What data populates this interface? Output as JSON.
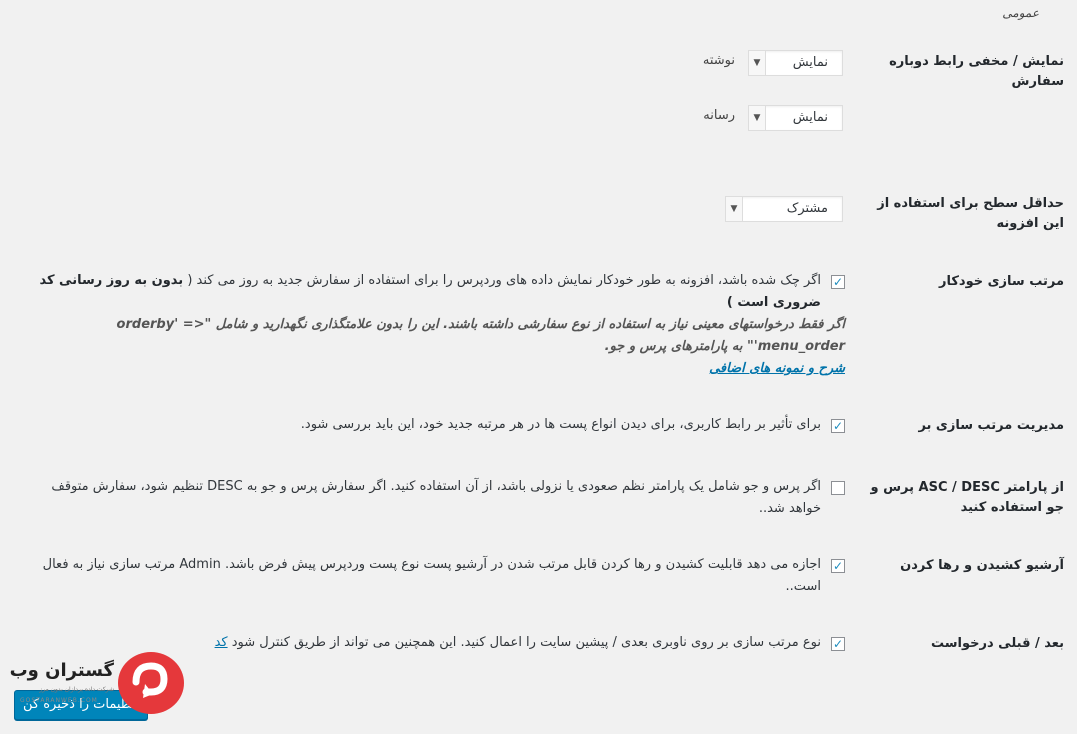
{
  "section_title": "عمومی",
  "rows": {
    "link_toggle": {
      "label": "نمایش / مخفی رابط دوباره سفارش",
      "post": {
        "select_value": "نمایش",
        "caption": "نوشته"
      },
      "media": {
        "select_value": "نمایش",
        "caption": "رسانه"
      }
    },
    "min_level": {
      "label": "حداقل سطح برای استفاده از این افزونه",
      "select_value": "مشترک"
    },
    "autosort": {
      "label": "مرتب سازی خودکار",
      "checked": true,
      "text": "اگر چک شده باشد، افزونه به طور خودکار نمایش داده های وردپرس را برای استفاده از سفارش جدید به روز می کند (",
      "bold": "بدون به روز رسانی کد ضروری است )",
      "note": "اگر فقط درخواستهای معینی نیاز به استفاده از نوع سفارشی داشته باشند. این را بدون علامتگذاری نگهدارید و شامل \"orderby' => 'menu_order\" به پارامترهای پرس و جو.",
      "link": "شرح و نمونه های اضافی"
    },
    "admin_sort": {
      "label": "مدیریت مرتب سازی بر",
      "checked": true,
      "text": "برای تأثیر بر رابط کاربری، برای دیدن انواع پست ها در هر مرتبه جدید خود، این باید بررسی شود."
    },
    "asc_desc": {
      "label": "از پارامتر ASC / DESC پرس و جو استفاده کنید",
      "checked": false,
      "text": "اگر پرس و جو شامل یک پارامتر نظم صعودی یا نزولی باشد، از آن استفاده کنید. اگر سفارش پرس و جو به DESC تنظیم شود، سفارش متوقف خواهد شد.."
    },
    "archive_drag": {
      "label": "آرشیو کشیدن و رها کردن",
      "checked": true,
      "text": "اجازه می دهد قابلیت کشیدن و رها کردن قابل مرتب شدن در آرشیو پست نوع پست وردپرس پیش فرض باشد. Admin مرتب سازی نیاز به فعال است.."
    },
    "next_prev": {
      "label": "بعد / قبلی درخواست",
      "checked": true,
      "text": "نوع مرتب سازی بر روی ناوبری بعدی / پیشین سایت را اعمال کنید. این همچنین می تواند از طریق کنترل شود",
      "link": "کد"
    }
  },
  "save_button": "تنظیمات را ذخیره کن",
  "logo": {
    "name": "گستران وب",
    "tagline": "شرکت داده پردازان بدون مرز",
    "url": "GOSTARANWEB.COM"
  },
  "colors": {
    "primary": "#0085ba",
    "link": "#0073aa",
    "logo_red": "#e5383b"
  }
}
